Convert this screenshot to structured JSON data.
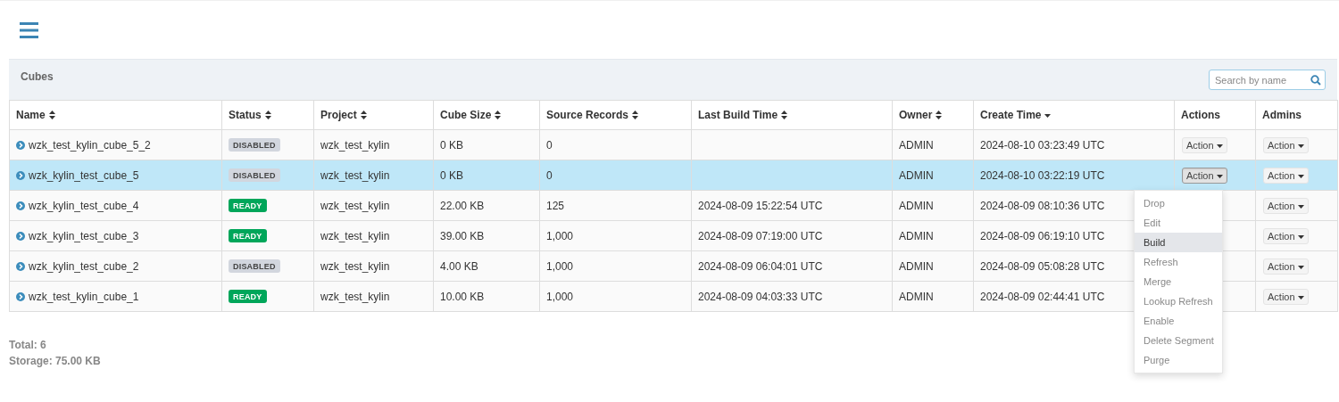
{
  "panel": {
    "title": "Cubes",
    "search": {
      "placeholder": "Search by name"
    }
  },
  "table": {
    "columns": [
      {
        "label": "Name",
        "sortable": true,
        "sorted": false
      },
      {
        "label": "Status",
        "sortable": true,
        "sorted": false
      },
      {
        "label": "Project",
        "sortable": true,
        "sorted": false
      },
      {
        "label": "Cube Size",
        "sortable": true,
        "sorted": false
      },
      {
        "label": "Source Records",
        "sortable": true,
        "sorted": false
      },
      {
        "label": "Last Build Time",
        "sortable": true,
        "sorted": false
      },
      {
        "label": "Owner",
        "sortable": true,
        "sorted": false
      },
      {
        "label": "Create Time",
        "sortable": true,
        "sorted": true
      },
      {
        "label": "Actions",
        "sortable": false,
        "sorted": false
      },
      {
        "label": "Admins",
        "sortable": false,
        "sorted": false
      }
    ],
    "rows": [
      {
        "selected": false,
        "name": "wzk_test_kylin_cube_5_2",
        "status": {
          "label": "DISABLED",
          "kind": "disabled"
        },
        "project": "wzk_test_kylin",
        "cube_size": "0 KB",
        "source_records": "0",
        "owner": "ADMIN",
        "create_time": "2024-08-10 03:23:49 UTC",
        "actions_button": {
          "label": "Action",
          "open": false
        },
        "admins_button": {
          "label": "Action"
        }
      },
      {
        "selected": true,
        "name": "wzk_kylin_test_cube_5",
        "status": {
          "label": "DISABLED",
          "kind": "disabled"
        },
        "project": "wzk_test_kylin",
        "cube_size": "0 KB",
        "source_records": "0",
        "owner": "ADMIN",
        "create_time": "2024-08-10 03:22:19 UTC",
        "actions_button": {
          "label": "Action",
          "open": true
        },
        "admins_button": {
          "label": "Action"
        }
      },
      {
        "selected": false,
        "name": "wzk_kylin_test_cube_4",
        "status": {
          "label": "READY",
          "kind": "ready"
        },
        "project": "wzk_test_kylin",
        "cube_size": "22.00 KB",
        "source_records": "125",
        "last_build_time": "2024-08-09 15:22:54 UTC",
        "owner": "ADMIN",
        "create_time": "2024-08-09 08:10:36 UTC",
        "admins_button": {
          "label": "Action"
        }
      },
      {
        "selected": false,
        "name": "wzk_kylin_test_cube_3",
        "status": {
          "label": "READY",
          "kind": "ready"
        },
        "project": "wzk_test_kylin",
        "cube_size": "39.00 KB",
        "source_records": "1,000",
        "last_build_time": "2024-08-09 07:19:00 UTC",
        "owner": "ADMIN",
        "create_time": "2024-08-09 06:19:10 UTC",
        "admins_button": {
          "label": "Action"
        }
      },
      {
        "selected": false,
        "name": "wzk_kylin_test_cube_2",
        "status": {
          "label": "DISABLED",
          "kind": "disabled"
        },
        "project": "wzk_test_kylin",
        "cube_size": "4.00 KB",
        "source_records": "1,000",
        "last_build_time": "2024-08-09 06:04:01 UTC",
        "owner": "ADMIN",
        "create_time": "2024-08-09 05:08:28 UTC",
        "admins_button": {
          "label": "Action"
        }
      },
      {
        "selected": false,
        "name": "wzk_test_kylin_cube_1",
        "status": {
          "label": "READY",
          "kind": "ready"
        },
        "project": "wzk_test_kylin",
        "cube_size": "10.00 KB",
        "source_records": "1,000",
        "last_build_time": "2024-08-09 04:03:33 UTC",
        "owner": "ADMIN",
        "create_time": "2024-08-09 02:44:41 UTC",
        "admins_button": {
          "label": "Action"
        }
      }
    ]
  },
  "action_menu": {
    "items": [
      {
        "label": "Drop",
        "selected": false
      },
      {
        "label": "Edit",
        "selected": false
      },
      {
        "label": "Build",
        "selected": true
      },
      {
        "label": "Refresh",
        "selected": false
      },
      {
        "label": "Merge",
        "selected": false
      },
      {
        "label": "Lookup Refresh",
        "selected": false
      },
      {
        "label": "Enable",
        "selected": false
      },
      {
        "label": "Delete Segment",
        "selected": false
      },
      {
        "label": "Purge",
        "selected": false
      }
    ]
  },
  "summary": {
    "total": "Total: 6",
    "storage": "Storage: 75.00 KB"
  }
}
